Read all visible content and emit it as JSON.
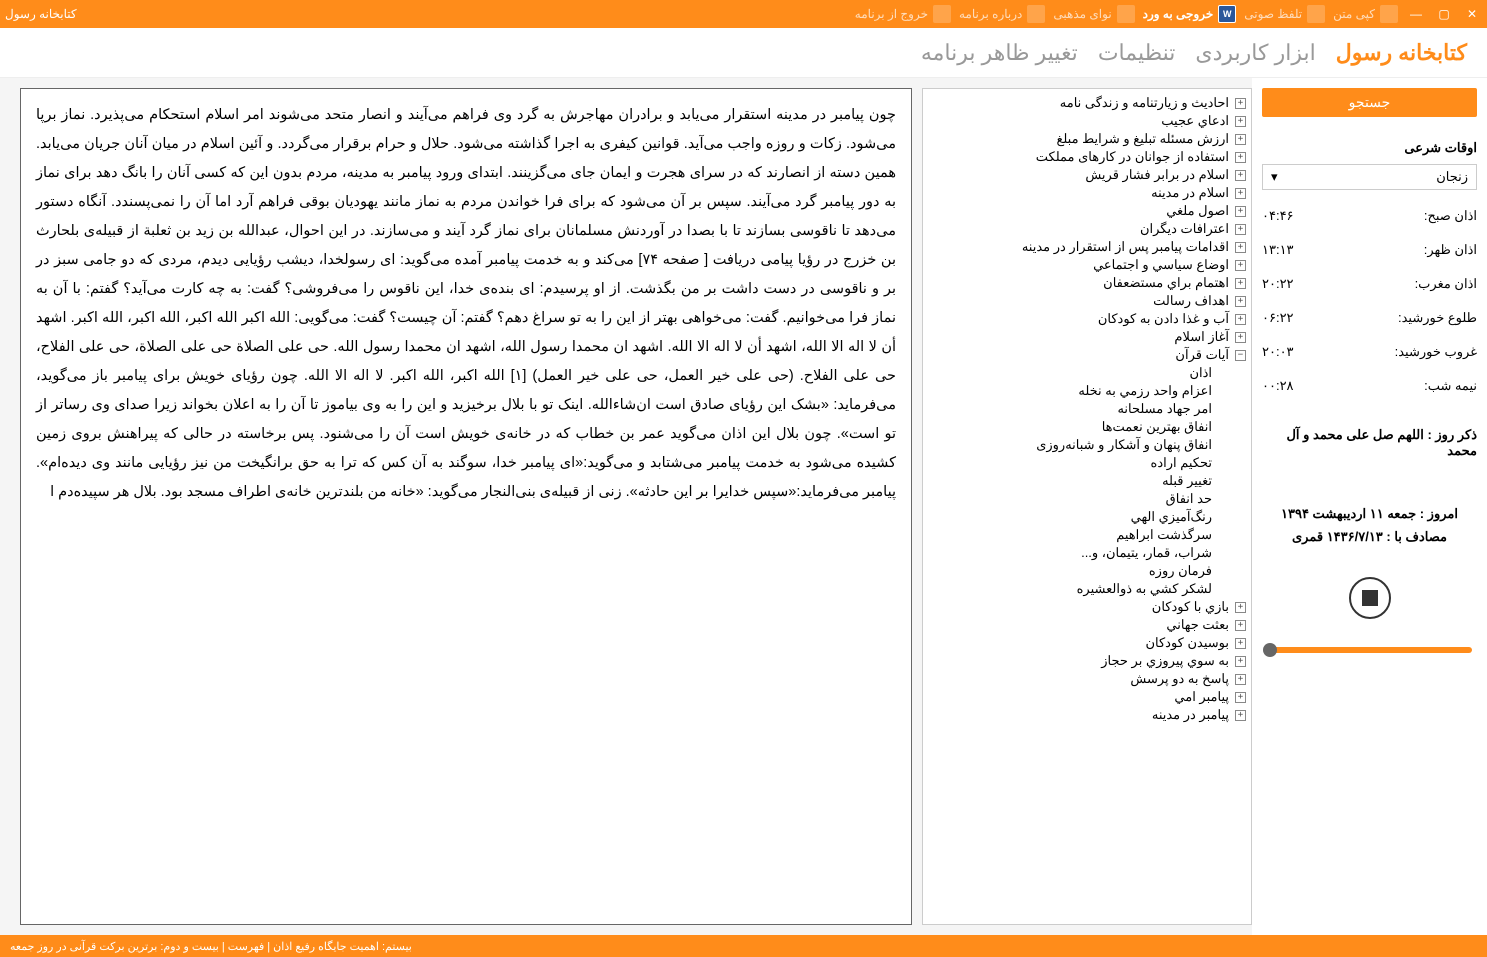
{
  "titlebar": {
    "app_title": "کتابخانه رسول",
    "items": [
      {
        "label": "کپی متن"
      },
      {
        "label": "تلفظ صوتی"
      },
      {
        "label": "خروجی به ورد"
      },
      {
        "label": "نوای مذهبی"
      },
      {
        "label": "درباره برنامه"
      },
      {
        "label": "خروج از برنامه"
      }
    ]
  },
  "menu": {
    "brand": "کتابخانه رسول",
    "items": [
      "ابزار کاربردی",
      "تنظیمات",
      "تغییر ظاهر برنامه"
    ]
  },
  "sidebar": {
    "search": "جستجو",
    "times_title": "اوقات شرعی",
    "city": "زنجان",
    "times": [
      {
        "label": "اذان صبح:",
        "value": "۰۴:۴۶"
      },
      {
        "label": "اذان ظهر:",
        "value": "۱۳:۱۳"
      },
      {
        "label": "اذان مغرب:",
        "value": "۲۰:۲۲"
      },
      {
        "label": "طلوع خورشید:",
        "value": "۰۶:۲۲"
      },
      {
        "label": "غروب خورشید:",
        "value": "۲۰:۰۳"
      },
      {
        "label": "نیمه شب:",
        "value": "۰۰:۲۸"
      }
    ],
    "zekr": "ذکر روز : اللهم صل علی محمد و آل محمد",
    "today": "امروز : جمعه ۱۱ اردیبهشت ۱۳۹۴",
    "hijri": "مصادف با : ۱۴۳۶/۷/۱۳ قمری"
  },
  "tree": {
    "top_level": [
      "احادیث و زیارتنامه و زندگی نامه",
      "ادعاي عجيب",
      "ارزش مسئله تبلیغ و شرایط مبلغ",
      "استفاده از جوانان در کارهای مملکت",
      "اسلام در برابر فشار قريش",
      "اسلام در مدينه",
      "اصول ملغي",
      "اعترافات ديگران",
      "اقدامات پيامبر پس از استقرار در مدينه",
      "اوضاع سياسي و اجتماعي",
      "اهتمام براي مستضعفان",
      "اهداف رسالت",
      "آب و غذا دادن به کودکان",
      "آغاز اسلام"
    ],
    "expanded_label": "آيات قرآن",
    "children": [
      "اذان",
      "اعزام واحد رزمي به نخله",
      "امر جهاد مسلحانه",
      "انفاق بهترین نعمت‌ها",
      "انفاق پنهان و آشکار و شبانه‌روزی",
      "تحکيم اراده",
      "تغيير قبله",
      "حد انفاق",
      "رنگ‌آميزي الهي",
      "سرگذشت ابراهيم",
      "شراب، قمار، يتيمان، و...",
      "فرمان روزه",
      "لشکر کشي به ذوالعشيره"
    ],
    "after_expanded": [
      "بازي با کودکان",
      "بعثت جهاني",
      "بوسيدن کودکان",
      "به سوي پيروزي بر حجاز",
      "پاسخ به دو پرسش",
      "پيامبر امي",
      "پيامبر در مدينه"
    ]
  },
  "content": {
    "text": "چون پیامبر در مدینه استقرار می‌یابد و برادران مهاجرش به گرد وی فراهم می‌آیند و انصار متحد می‌شوند امر اسلام استحکام می‌پذیرد. نماز برپا می‌شود. زکات و روزه واجب می‌آید. قوانین کیفری به اجرا گذاشته می‌شود. حلال و حرام برقرار می‌گردد. و آئین اسلام در میان آنان جریان می‌یابد. همین دسته از انصارند که در سرای هجرت و ایمان جای می‌گزینند. ابتدای ورود پیامبر به مدینه، مردم بدون این که کسی آنان را بانگ دهد برای نماز به دور پیامبر گرد می‌آیند. سپس بر آن می‌شود که برای فرا خواندن مردم به نماز مانند یهودیان بوقی فراهم آرد اما آن را نمی‌پسندد. آنگاه دستور می‌دهد تا ناقوسی بسازند تا با بصدا در آوردنش مسلمانان برای نماز گرد آیند و می‌سازند. در این احوال، عبدالله بن زید بن ثعلبة از قبیله‌ی بلحارث بن خزرج در رؤیا پیامی دریافت [ صفحه ۷۴] می‌کند و به خدمت پیامبر آمده می‌گوید: ای رسولخدا، دیشب رؤیایی دیدم، مردی که دو جامی سبز در بر و ناقوسی در دست داشت بر من بگذشت. از او پرسیدم: ای بنده‌ی خدا، این ناقوس را می‌فروشی؟ گفت: به چه کارت می‌آید؟ گفتم: با آن به نماز فرا می‌خوانیم. گفت: می‌خواهی بهتر از این را به تو سراغ دهم؟ گفتم: آن چیست؟ گفت: می‌گویی: الله اکبر الله اکبر، الله اکبر، الله اکبر. اشهد أن لا اله الا الله، اشهد أن لا اله الا الله. اشهد ان محمدا رسول الله، اشهد ان محمدا رسول الله. حی علی الصلاة حی علی الصلاة، حی علی الفلاح، حی علی الفلاح. (حی علی خیر العمل، حی علی خیر العمل) [۱] الله اکبر، الله اکبر. لا اله الا الله. چون رؤیای خویش برای پیامبر باز می‌گوید، می‌فرماید: «بشک این رؤیای صادق است ان‌شاءالله. اینک تو با بلال برخیزید و این را به وی بیاموز تا آن را به اعلان بخواند زیرا صدای وی رساتر از تو است». چون بلال این اذان می‌گوید عمر بن خطاب که در خانه‌ی خویش است آن را می‌شنود. پس برخاسته در حالی که پیراهنش بروی زمین کشیده می‌شود به خدمت پیامبر می‌شتابد و می‌گوید:«ای پیامبر خدا، سوگند به آن کس که ترا به حق برانگیخت من نیز رؤیایی مانند وی دیده‌ام». پیامبر می‌فرماید:«سپس خدایرا بر این حادثه». زنی از قبیله‌ی بنی‌النجار می‌گوید: «خانه من بلندترین خانه‌ی اطراف مسجد بود. بلال هر سپیده‌دم ا"
  },
  "statusbar": "بیستم: اهمیت جایگاه رفیع اذان | فهرست | بیست و دوم: برترین برکت قرآنی در روز جمعه"
}
